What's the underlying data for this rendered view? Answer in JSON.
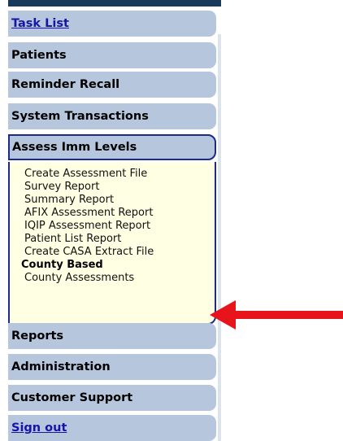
{
  "sidebar": {
    "items": [
      {
        "label": "Task List"
      },
      {
        "label": "Patients"
      },
      {
        "label": "Reminder Recall"
      },
      {
        "label": "System Transactions"
      },
      {
        "label": "Assess Imm Levels"
      },
      {
        "label": "Reports"
      },
      {
        "label": "Administration"
      },
      {
        "label": "Customer Support"
      },
      {
        "label": "Sign out"
      }
    ],
    "submenu": {
      "items": [
        {
          "label": "Create Assessment File"
        },
        {
          "label": "Survey Report"
        },
        {
          "label": "Summary Report"
        },
        {
          "label": "AFIX Assessment Report"
        },
        {
          "label": "IQIP Assessment Report"
        },
        {
          "label": "Patient List Report"
        },
        {
          "label": "Create CASA Extract File"
        }
      ],
      "section_heading": "County Based",
      "section_items": [
        {
          "label": "County Assessments"
        }
      ]
    }
  },
  "annotation": {
    "arrow_color": "#e8141c",
    "icon": "red-arrow-pointing-left"
  },
  "colors": {
    "nav_background": "#b6c6dc",
    "submenu_background": "#ffffe4",
    "active_border": "#1c2a8a",
    "link": "#1515a8"
  }
}
